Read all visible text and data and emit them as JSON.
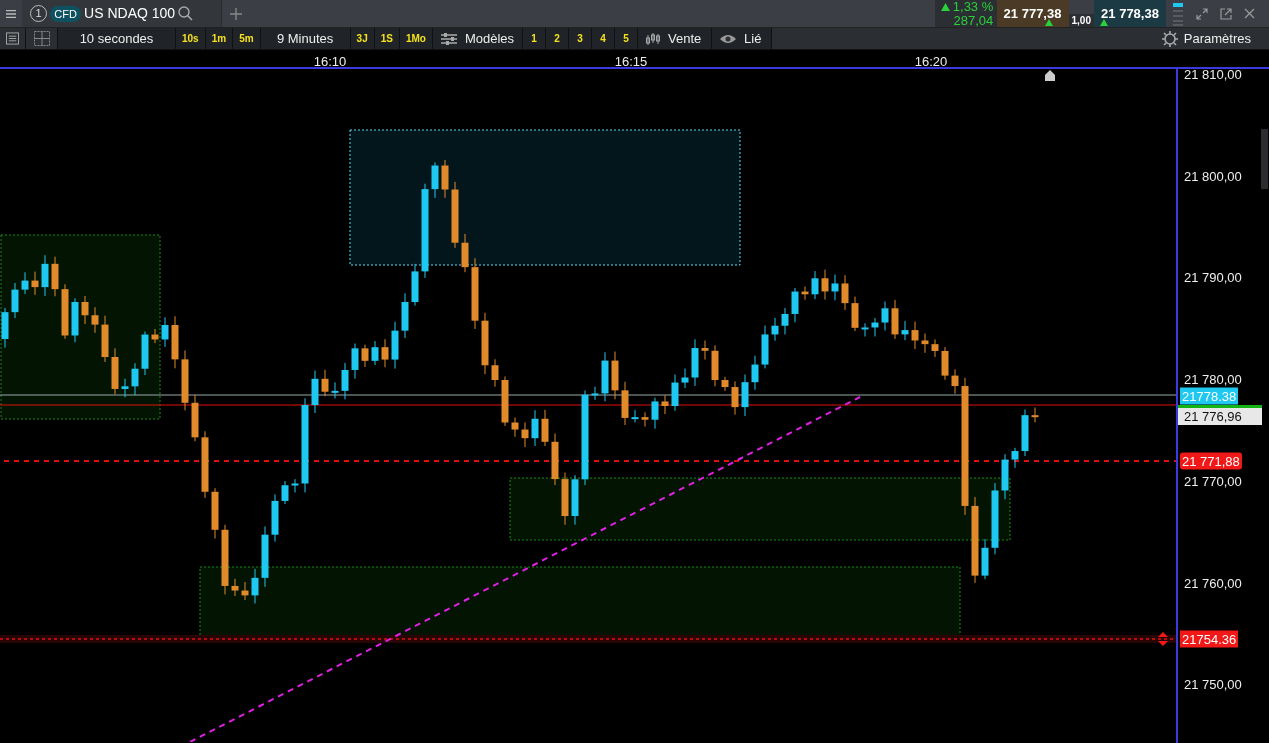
{
  "tab": {
    "number": "1",
    "instrument_type": "CFD",
    "instrument": "US NDAQ 100"
  },
  "quote": {
    "change_pct": "1,33 %",
    "change_points": "287,04",
    "bid": "21 777,38",
    "spread": "1,00",
    "ask": "21 778,38"
  },
  "toolbar": {
    "interval": "10 secondes",
    "interval_buttons": [
      "10s",
      "1m",
      "5m"
    ],
    "range": "9 Minutes",
    "range_buttons": [
      "3J",
      "1S",
      "1Mo"
    ],
    "templates": "Modèles",
    "layouts": [
      "1",
      "2",
      "3",
      "4",
      "5"
    ],
    "order": "Vente",
    "linked": "Lié",
    "settings": "Paramètres"
  },
  "chart": {
    "time_labels": [
      "16:10",
      "16:15",
      "16:20"
    ],
    "price_labels": [
      "21 810,00",
      "21 800,00",
      "21 790,00",
      "21 780,00",
      "21 770,00",
      "21 760,00",
      "21 750,00"
    ],
    "price_tags": [
      {
        "kind": "last",
        "text": "21778.38"
      },
      {
        "kind": "bid",
        "text": "21 776,96"
      },
      {
        "kind": "alert",
        "text": "21 771,88"
      },
      {
        "kind": "order",
        "text": "21754.36"
      }
    ]
  }
}
